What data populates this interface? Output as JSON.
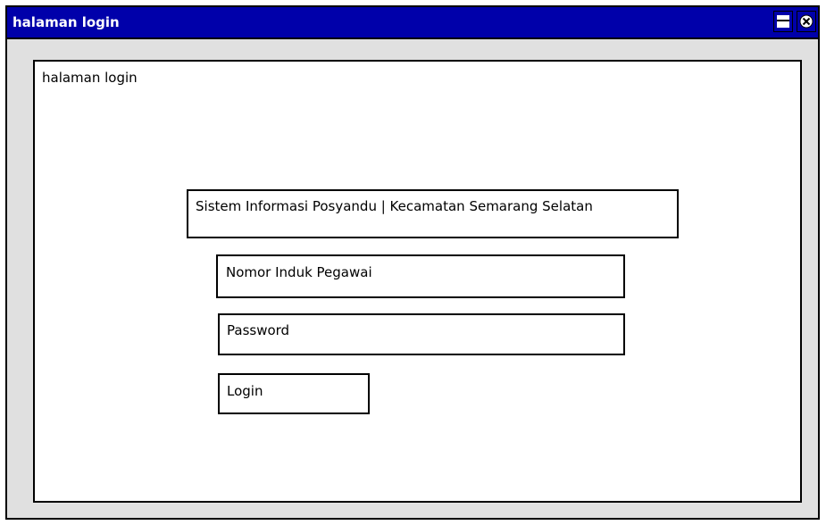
{
  "window": {
    "title": "halaman login",
    "controls": {
      "maximize_icon": "maximize-icon",
      "close_icon": "close-icon"
    },
    "colors": {
      "titlebar": "#0000aa",
      "frame": "#e0e0e0"
    }
  },
  "panel": {
    "label": "halaman login"
  },
  "form": {
    "header": "Sistem Informasi Posyandu | Kecamatan Semarang Selatan",
    "nip_label": "Nomor Induk Pegawai",
    "password_label": "Password",
    "login_label": "Login"
  }
}
